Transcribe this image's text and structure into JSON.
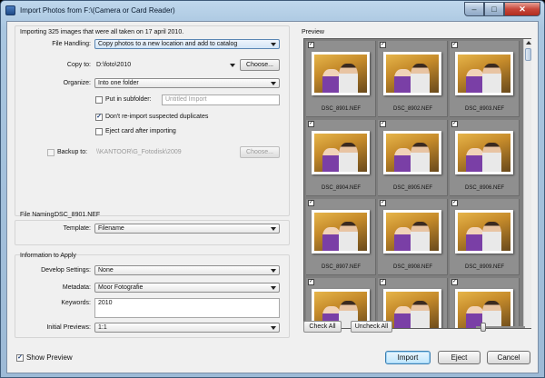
{
  "window": {
    "title": "Import Photos from F:\\(Camera or Card Reader)"
  },
  "summary": "Importing 325 images that were all taken on 17 april 2010.",
  "file_handling": {
    "label": "File Handling:",
    "value": "Copy photos to a new location and add to catalog"
  },
  "copy_to": {
    "label": "Copy to:",
    "path": "D:\\foto\\2010",
    "button": "Choose..."
  },
  "organize": {
    "label": "Organize:",
    "value": "Into one folder"
  },
  "subfolder": {
    "label": "Put in subfolder:",
    "checked": false,
    "placeholder": "Untitled Import"
  },
  "dont_reimport": {
    "label": "Don't re-import suspected duplicates",
    "checked": true
  },
  "eject_card": {
    "label": "Eject card after importing",
    "checked": false
  },
  "backup": {
    "label": "Backup to:",
    "checked": false,
    "path": "\\\\KANTOOR\\G_Fotodisk\\2009",
    "button": "Choose..."
  },
  "file_naming": {
    "label": "File Naming:",
    "example": "DSC_8901.NEF",
    "template_label": "Template:",
    "template_value": "Filename"
  },
  "info": {
    "section_label": "Information to Apply",
    "develop_label": "Develop Settings:",
    "develop_value": "None",
    "metadata_label": "Metadata:",
    "metadata_value": "Moor Fotografie",
    "keywords_label": "Keywords:",
    "keywords_value": "2010",
    "previews_label": "Initial Previews:",
    "previews_value": "1:1"
  },
  "preview": {
    "title": "Preview",
    "files": [
      "DSC_8901.NEF",
      "DSC_8902.NEF",
      "DSC_8903.NEF",
      "DSC_8904.NEF",
      "DSC_8905.NEF",
      "DSC_8906.NEF",
      "DSC_8907.NEF",
      "DSC_8908.NEF",
      "DSC_8909.NEF",
      "",
      "",
      ""
    ],
    "check_all": "Check All",
    "uncheck_all": "Uncheck All",
    "thumb_size": 0.1
  },
  "show_preview": {
    "label": "Show Preview",
    "checked": true
  },
  "actions": {
    "import": "Import",
    "eject": "Eject",
    "cancel": "Cancel"
  },
  "window_buttons": {
    "minimize": "–",
    "maximize": "□",
    "close": "✕"
  }
}
